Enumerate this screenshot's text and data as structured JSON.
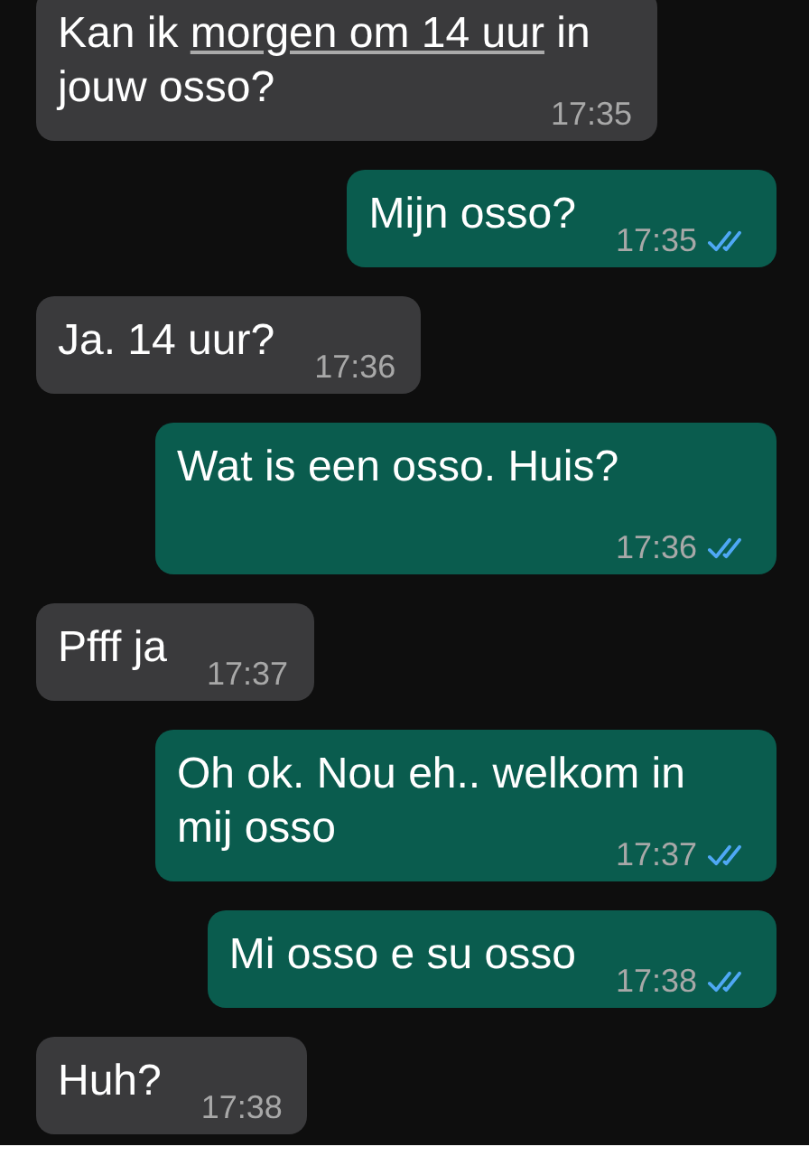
{
  "messages": [
    {
      "kind": "in",
      "parts": [
        {
          "text": "Kan ik ",
          "link": false
        },
        {
          "text": "morgen om 14 uur",
          "link": true
        },
        {
          "text": " in jouw osso?",
          "link": false
        }
      ],
      "time": "17:35"
    },
    {
      "kind": "out",
      "parts": [
        {
          "text": "Mijn osso?",
          "link": false
        }
      ],
      "time": "17:35",
      "read": true
    },
    {
      "kind": "in",
      "parts": [
        {
          "text": "Ja. 14 uur?",
          "link": false
        }
      ],
      "time": "17:36"
    },
    {
      "kind": "out",
      "parts": [
        {
          "text": "Wat is een osso. Huis?",
          "link": false
        }
      ],
      "time": "17:36",
      "read": true
    },
    {
      "kind": "in",
      "parts": [
        {
          "text": "Pfff ja",
          "link": false
        }
      ],
      "time": "17:37"
    },
    {
      "kind": "out",
      "parts": [
        {
          "text": "Oh ok. Nou eh.. welkom in mij osso",
          "link": false
        }
      ],
      "time": "17:37",
      "read": true
    },
    {
      "kind": "out",
      "parts": [
        {
          "text": "Mi osso e su osso",
          "link": false
        }
      ],
      "time": "17:38",
      "read": true
    },
    {
      "kind": "in",
      "parts": [
        {
          "text": "Huh?",
          "link": false
        }
      ],
      "time": "17:38"
    }
  ]
}
